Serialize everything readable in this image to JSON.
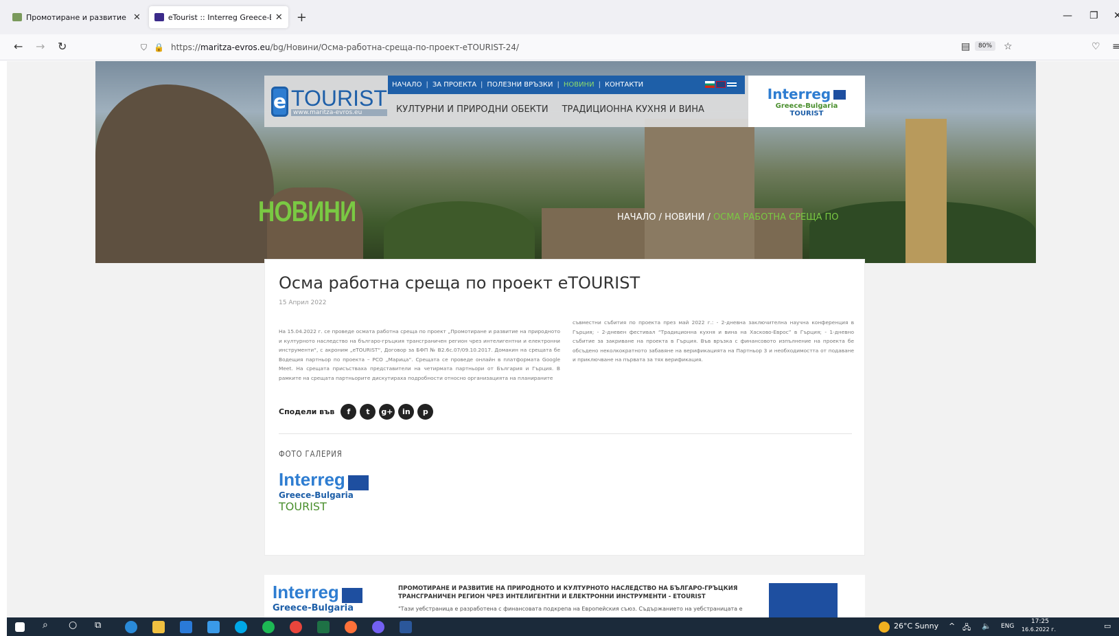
{
  "browser": {
    "tabs": [
      {
        "title": "Промотиране и развитие на п",
        "active": false
      },
      {
        "title": "eTourist :: Interreg Greece-Bulga",
        "active": true
      }
    ],
    "url_prefix": "https://",
    "url_domain": "maritza-evros.eu",
    "url_path": "/bg/Новини/Осма-работна-среща-по-проект-eTOURIST-24/",
    "zoom": "80%"
  },
  "header": {
    "logo_word": "TOURIST",
    "logo_url": "www.maritza-evros.eu",
    "top_menu": [
      "НАЧАЛО",
      "ЗА ПРОЕКТА",
      "ПОЛЕЗНИ ВРЪЗКИ",
      "НОВИНИ",
      "КОНТАКТИ"
    ],
    "main_menu": [
      "КУЛТУРНИ И ПРИРОДНИ ОБЕКТИ",
      "ТРАДИЦИОННА КУХНЯ И ВИНА"
    ],
    "interreg_word": "Interreg",
    "interreg_sub": "Greece-Bulgaria",
    "interreg_etourist": "TOURIST"
  },
  "hero": {
    "title": "НОВИНИ",
    "breadcrumb_home": "НАЧАЛО",
    "breadcrumb_news": "НОВИНИ",
    "breadcrumb_current": "ОСМА РАБОТНА СРЕЩА ПО"
  },
  "article": {
    "title": "Осма работна среща по проект eTOURIST",
    "date": "15 Април 2022",
    "col1": "На 15.04.2022 г. се проведе осмата работна среща по проект „Промотиране и развитие на природното и културното наследство на българо-гръцкия трансграничен регион чрез интелигентни и електронни инструменти“, с акроним „eTOURIST“, Договор за БФП № B2.6c.07/09.10.2017. Домакин на срещата бе Водещия партньор по проекта – РСО „Марица“. Срещата се проведе онлайн в платформата Google Meet. На срещата присъстваха представители на четирмата партньори от България и Гърция. В рамките на срещата партньорите дискутираха подробности относно организацията на планираните",
    "col2": "съвместни събития по проекта през май 2022 г.: - 2-дневна заключителна научна конференция в Гърция; - 2-дневен фестивал “Традиционна кухня и вина на Хасково-Еврос” в Гърция; - 1-дневно събитие за закриване на проекта в Гърция. Във връзка с финансовото изпълнение на проекта бе обсъдено неколкократното забавяне на верификацията на Партньор 3 и необходимостта от подаване и приключване на първата за тях верификация.",
    "share_label": "Сподели във",
    "share_icons": [
      "f",
      "t",
      "g+",
      "in",
      "p"
    ],
    "gallery_title": "ФОТО ГАЛЕРИЯ",
    "gallery_word": "Interreg",
    "gallery_sub": "Greece-Bulgaria",
    "gallery_et": "TOURIST"
  },
  "footer": {
    "interreg_word": "Interreg",
    "interreg_sub": "Greece-Bulgaria",
    "text": "ПРОМОТИРАНЕ И РАЗВИТИЕ НА ПРИРОДНОТО И КУЛТУРНОТО НАСЛЕДСТВО НА БЪЛГАРО-ГРЪЦКИЯ ТРАНСГРАНИЧЕН РЕГИОН ЧРЕЗ ИНТЕЛИГЕНТНИ И ЕЛЕКТРОННИ ИНСТРУМЕНТИ - ETOURIST",
    "note": "\"Тази уебстраница е разработена с финансовата подкрепа на Европейския съюз. Съдържанието на уебстраницата е"
  },
  "taskbar": {
    "weather": "26°C  Sunny",
    "lang": "ENG",
    "time": "17:25",
    "date": "16.6.2022 г."
  }
}
